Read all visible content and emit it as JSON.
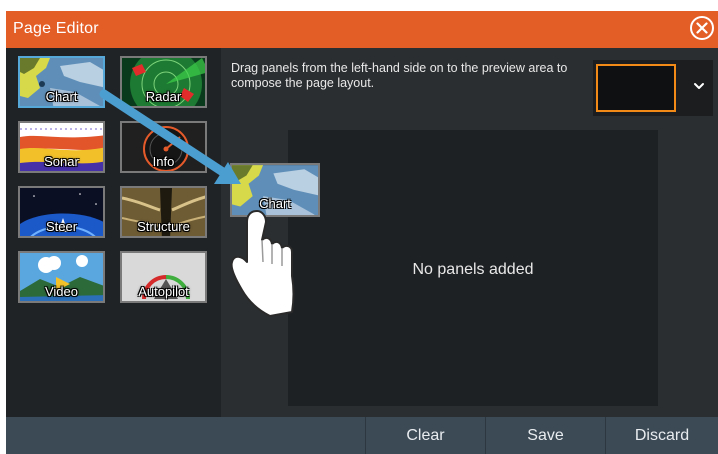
{
  "window": {
    "title": "Page Editor"
  },
  "panels": [
    {
      "label": "Chart",
      "selected": true
    },
    {
      "label": "Radar",
      "selected": false
    },
    {
      "label": "Sonar",
      "selected": false
    },
    {
      "label": "Info",
      "selected": false
    },
    {
      "label": "Steer",
      "selected": false
    },
    {
      "label": "Structure",
      "selected": false
    },
    {
      "label": "Video",
      "selected": false
    },
    {
      "label": "Autopilot",
      "selected": false
    }
  ],
  "instruction": "Drag panels from the left-hand side on to the preview area to compose the page layout.",
  "preview": {
    "empty_text": "No panels added"
  },
  "dragging": {
    "label": "Chart"
  },
  "buttons": {
    "clear": "Clear",
    "save": "Save",
    "discard": "Discard"
  },
  "colors": {
    "title_bar": "#e35d27",
    "selection": "#56a8d8",
    "layout_highlight": "#f28a18",
    "arrow": "#4a9ed0"
  },
  "icons": {
    "close": "close-icon",
    "dropdown": "chevron-down-icon",
    "drag_hand": "hand-pointer-icon",
    "drag_arrow": "arrow-icon"
  }
}
